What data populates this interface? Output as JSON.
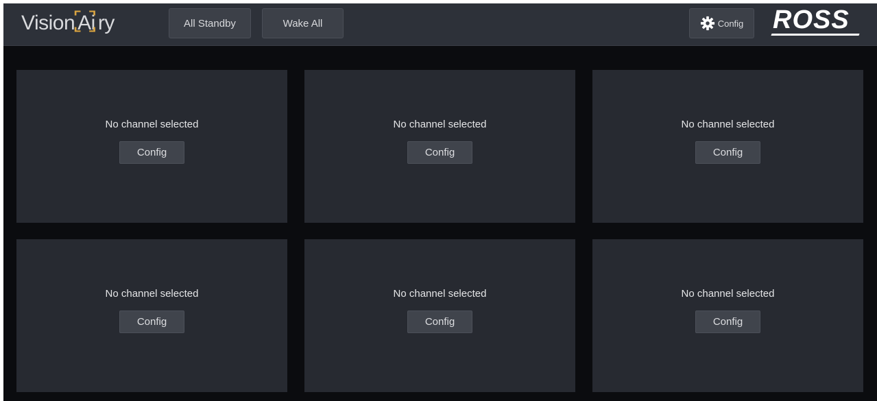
{
  "app": {
    "logo_text_before": "Vision",
    "logo_text_ai": "Ai",
    "logo_text_after": "ry",
    "brand": "ROSS",
    "accent_color": "#d9a441"
  },
  "toolbar": {
    "all_standby_label": "All Standby",
    "wake_all_label": "Wake All",
    "config_label": "Config",
    "config_icon": "gear-icon"
  },
  "panels": [
    {
      "message": "No channel selected",
      "button": "Config"
    },
    {
      "message": "No channel selected",
      "button": "Config"
    },
    {
      "message": "No channel selected",
      "button": "Config"
    },
    {
      "message": "No channel selected",
      "button": "Config"
    },
    {
      "message": "No channel selected",
      "button": "Config"
    },
    {
      "message": "No channel selected",
      "button": "Config"
    }
  ]
}
